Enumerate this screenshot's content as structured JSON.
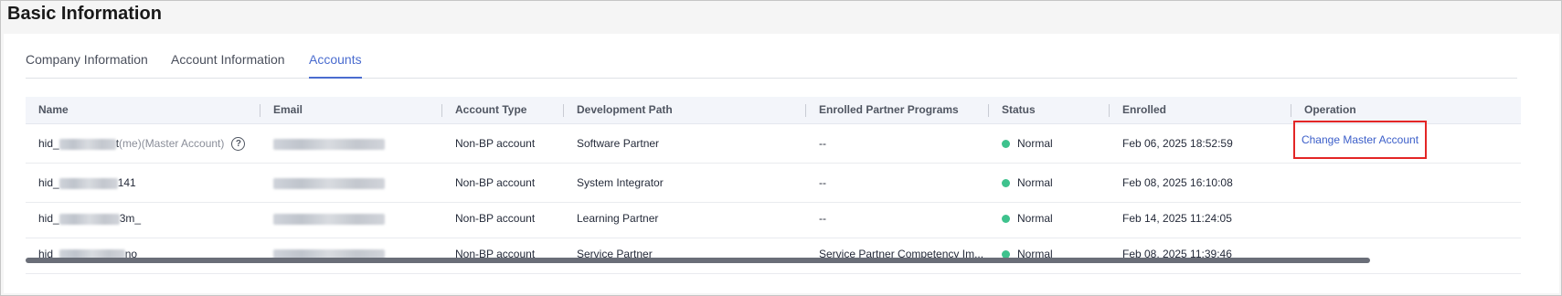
{
  "page": {
    "title": "Basic Information"
  },
  "tabs": [
    {
      "label": "Company Information",
      "active": false
    },
    {
      "label": "Account Information",
      "active": false
    },
    {
      "label": "Accounts",
      "active": true
    }
  ],
  "table": {
    "columns": [
      "Name",
      "Email",
      "Account Type",
      "Development Path",
      "Enrolled Partner Programs",
      "Status",
      "Enrolled",
      "Operation"
    ],
    "rows": [
      {
        "name_prefix": "hid_",
        "name_suffix": "t",
        "name_tag": "(me)(Master Account)",
        "account_type": "Non-BP account",
        "development_path": "Software Partner",
        "programs": "--",
        "status": "Normal",
        "enrolled": "Feb 06, 2025 18:52:59",
        "operation": "Change Master Account"
      },
      {
        "name_prefix": "hid_",
        "name_suffix": "141",
        "account_type": "Non-BP account",
        "development_path": "System Integrator",
        "programs": "--",
        "status": "Normal",
        "enrolled": "Feb 08, 2025 16:10:08"
      },
      {
        "name_prefix": "hid_",
        "name_suffix": "3m_",
        "account_type": "Non-BP account",
        "development_path": "Learning Partner",
        "programs": "--",
        "status": "Normal",
        "enrolled": "Feb 14, 2025 11:24:05"
      },
      {
        "name_prefix": "hid_",
        "name_suffix": "no",
        "account_type": "Non-BP account",
        "development_path": "Service Partner",
        "programs": "Service Partner Competency Im...",
        "status": "Normal",
        "enrolled": "Feb 08, 2025 11:39:46"
      }
    ]
  },
  "colors": {
    "accent": "#4a6ccf",
    "status_normal": "#3ec28d",
    "highlight_border": "#e32626"
  },
  "icons": {
    "help": "question-circle-icon",
    "status": "status-dot-icon"
  }
}
